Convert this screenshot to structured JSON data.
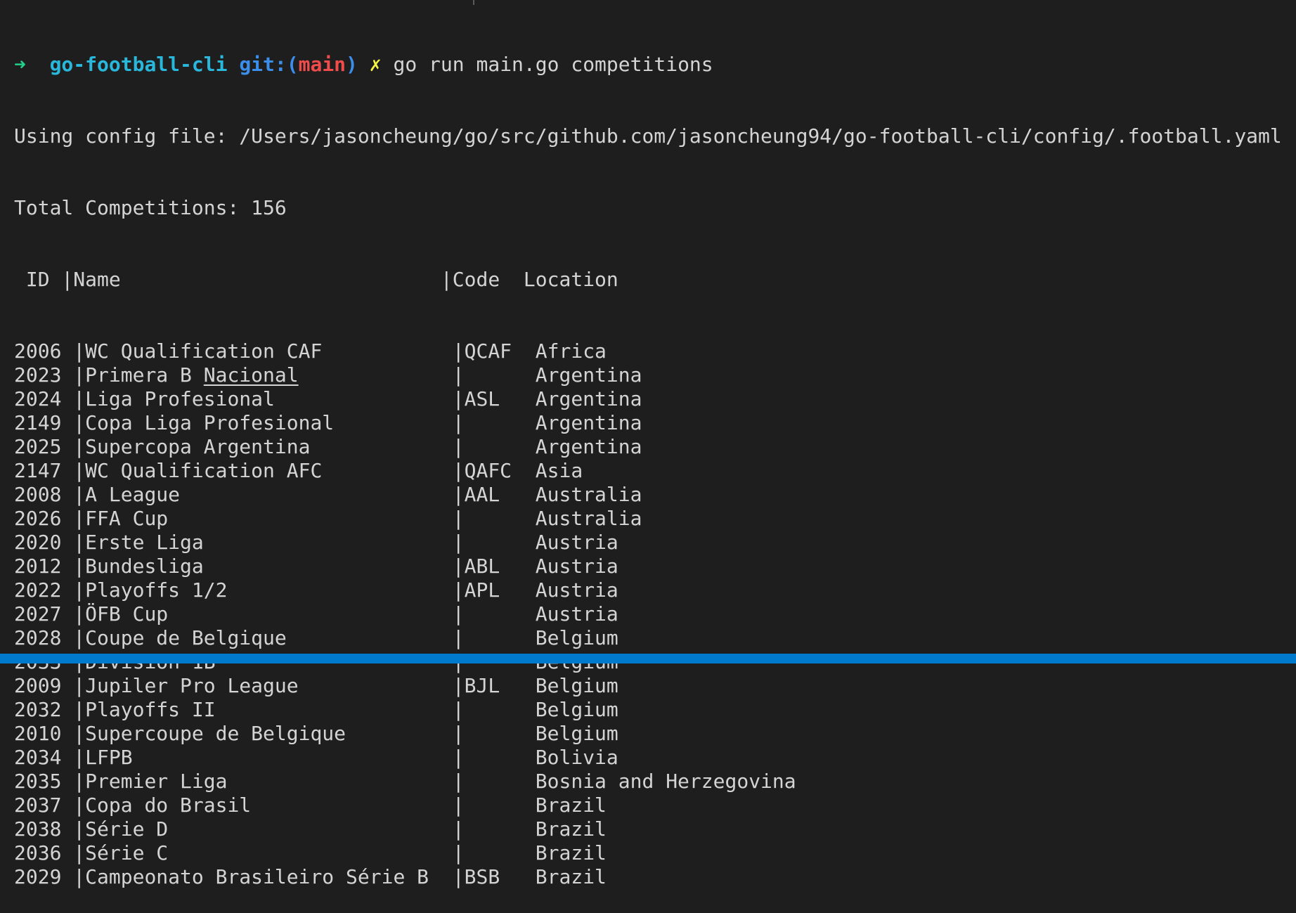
{
  "prompt": {
    "arrow": "➜",
    "directory": "go-football-cli",
    "git_prefix": "git:(",
    "branch": "main",
    "git_suffix": ")",
    "dirty_mark": "✗",
    "command": "go run main.go competitions"
  },
  "output": {
    "config_line": "Using config file: /Users/jasoncheung/go/src/github.com/jasoncheung94/go-football-cli/config/.football.yaml",
    "total_line": "Total Competitions: 156"
  },
  "table": {
    "headers": {
      "id": "ID",
      "name": "Name",
      "code": "Code",
      "location": "Location"
    },
    "rows": [
      {
        "id": "2006",
        "name": "WC Qualification CAF",
        "code": "QCAF",
        "location": "Africa"
      },
      {
        "id": "2023",
        "name_main": "Primera B",
        "name_underlined": "Nacional",
        "code": "",
        "location": "Argentina"
      },
      {
        "id": "2024",
        "name": "Liga Profesional",
        "code": "ASL",
        "location": "Argentina"
      },
      {
        "id": "2149",
        "name": "Copa Liga Profesional",
        "code": "",
        "location": "Argentina"
      },
      {
        "id": "2025",
        "name": "Supercopa Argentina",
        "code": "",
        "location": "Argentina"
      },
      {
        "id": "2147",
        "name": "WC Qualification AFC",
        "code": "QAFC",
        "location": "Asia"
      },
      {
        "id": "2008",
        "name": "A League",
        "code": "AAL",
        "location": "Australia"
      },
      {
        "id": "2026",
        "name": "FFA Cup",
        "code": "",
        "location": "Australia"
      },
      {
        "id": "2020",
        "name": "Erste Liga",
        "code": "",
        "location": "Austria"
      },
      {
        "id": "2012",
        "name": "Bundesliga",
        "code": "ABL",
        "location": "Austria"
      },
      {
        "id": "2022",
        "name": "Playoffs 1/2",
        "code": "APL",
        "location": "Austria"
      },
      {
        "id": "2027",
        "name": "ÖFB Cup",
        "code": "",
        "location": "Austria"
      },
      {
        "id": "2028",
        "name": "Coupe de Belgique",
        "code": "",
        "location": "Belgium"
      },
      {
        "id": "2033",
        "name": "Division 1B",
        "code": "",
        "location": "Belgium"
      },
      {
        "id": "2009",
        "name": "Jupiler Pro League",
        "code": "BJL",
        "location": "Belgium"
      },
      {
        "id": "2032",
        "name": "Playoffs II",
        "code": "",
        "location": "Belgium"
      },
      {
        "id": "2010",
        "name": "Supercoupe de Belgique",
        "code": "",
        "location": "Belgium"
      },
      {
        "id": "2034",
        "name": "LFPB",
        "code": "",
        "location": "Bolivia"
      },
      {
        "id": "2035",
        "name": "Premier Liga",
        "code": "",
        "location": "Bosnia and Herzegovina"
      },
      {
        "id": "2037",
        "name": "Copa do Brasil",
        "code": "",
        "location": "Brazil"
      },
      {
        "id": "2038",
        "name": "Série D",
        "code": "",
        "location": "Brazil"
      },
      {
        "id": "2036",
        "name": "Série C",
        "code": "",
        "location": "Brazil"
      },
      {
        "id": "2029",
        "name": "Campeonato Brasileiro Série B",
        "code": "BSB",
        "location": "Brazil"
      }
    ]
  },
  "colors": {
    "background": "#1e1e1e",
    "text": "#d4d4d4",
    "prompt_arrow": "#23d18b",
    "directory": "#29b8db",
    "git": "#3b8eea",
    "branch": "#f14c4c",
    "dirty_mark": "#f5f543",
    "status_bar": "#007acc"
  }
}
